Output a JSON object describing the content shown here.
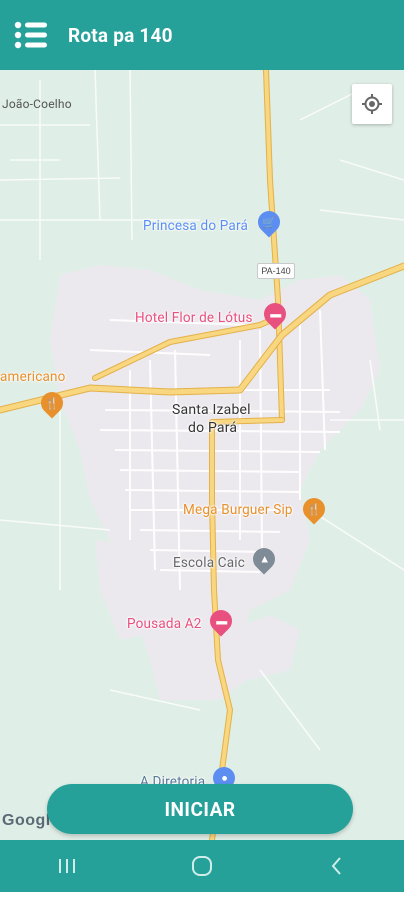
{
  "appbar": {
    "menu_icon": "menu-list-icon",
    "title": "Rota pa 140"
  },
  "map": {
    "my_location_icon": "my-location-icon",
    "road_shield": "PA-140",
    "labels": {
      "joao_coelho": "João-Coelho",
      "princesa": "Princesa do Pará",
      "hotel": "Hotel Flor de Lótus",
      "americano": "americano",
      "city_line1": "Santa Izabel",
      "city_line2": "do Pará",
      "mega": "Mega Burguer Sip",
      "escola": "Escola Caic",
      "pousada": "Pousada A2",
      "diretoria": "A Diretoria"
    },
    "attribution": "Google"
  },
  "start_button": {
    "label": "INICIAR"
  },
  "navbar": {
    "recents_icon": "recent-apps-icon",
    "home_icon": "home-circle-icon",
    "back_icon": "back-chevron-icon"
  },
  "colors": {
    "primary": "#26a19a",
    "map_bg": "#dfeee6",
    "urban": "#ece9ee",
    "road_major": "#f6c453",
    "poi_pink": "#e8507f",
    "poi_blue": "#5b8ef0",
    "poi_orange": "#e8902b",
    "poi_gray": "#7f8b96"
  }
}
